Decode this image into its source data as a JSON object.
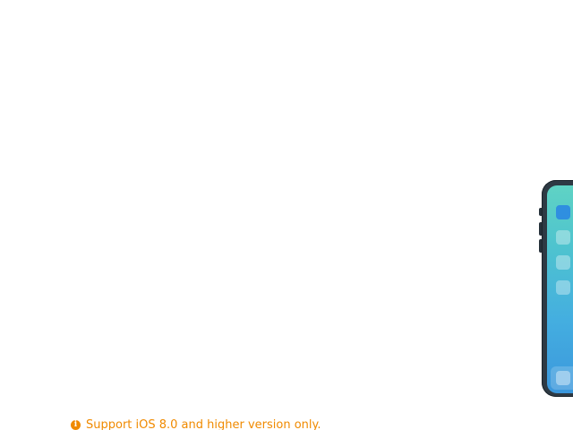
{
  "support_note": {
    "icon": "info-icon",
    "text": "Support iOS 8.0 and higher version only."
  },
  "phone_illustration": {
    "icon": "iphone-illustration"
  },
  "colors": {
    "accent": "#f08a00",
    "phone_frame": "#2e3a44",
    "screen_top": "#5fd3c4",
    "screen_bottom": "#3b97dc"
  }
}
